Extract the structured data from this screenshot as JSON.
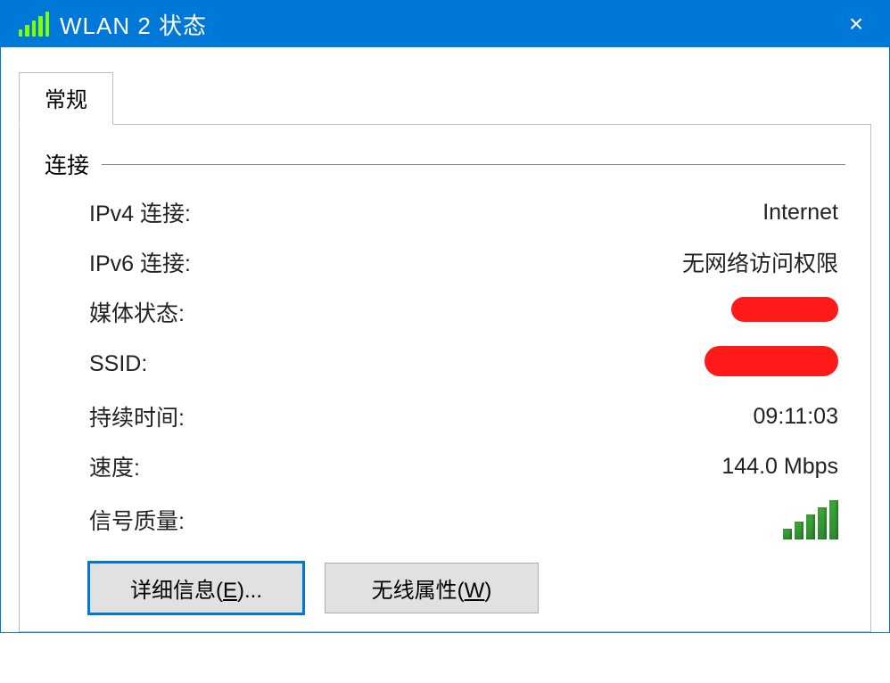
{
  "titlebar": {
    "title": "WLAN 2 状态",
    "close_label": "×"
  },
  "tabs": {
    "general": "常规"
  },
  "section": {
    "connection": "连接"
  },
  "labels": {
    "ipv4": "IPv4 连接:",
    "ipv6": "IPv6 连接:",
    "media_state": "媒体状态:",
    "ssid": "SSID:",
    "duration": "持续时间:",
    "speed": "速度:",
    "signal_quality": "信号质量:"
  },
  "values": {
    "ipv4": "Internet",
    "ipv6": "无网络访问权限",
    "media_state": "[redacted]",
    "ssid": "[redacted]",
    "duration": "09:11:03",
    "speed": "144.0 Mbps"
  },
  "buttons": {
    "details_prefix": "详细信息(",
    "details_mnemonic": "E",
    "details_suffix": ")...",
    "wireless_prefix": "无线属性(",
    "wireless_mnemonic": "W",
    "wireless_suffix": ")"
  }
}
